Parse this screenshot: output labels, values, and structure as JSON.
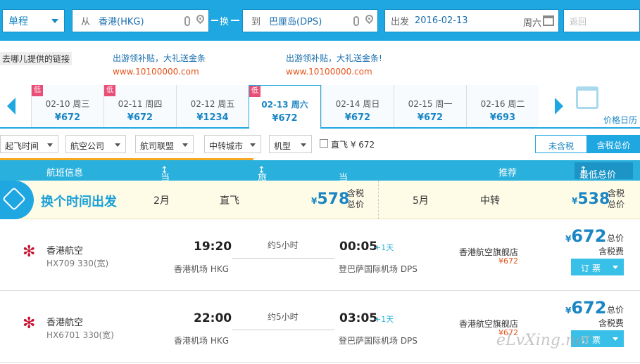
{
  "search": {
    "trip_type": "单程",
    "from_prefix": "从",
    "from_city": "香港(HKG)",
    "swap_label": "换",
    "to_prefix": "到",
    "to_city": "巴厘岛(DPS)",
    "depart_label": "出发",
    "depart_date": "2016-02-13",
    "weekday": "周六",
    "return_placeholder": "返回"
  },
  "ads": {
    "label": "去哪儿提供的链接",
    "items": [
      {
        "title": "出游领补贴，大礼送金条",
        "url": "www.10100000.com"
      },
      {
        "title": "出游领补贴，大礼送金条!",
        "url": "www.10100000.com"
      }
    ]
  },
  "dates": [
    {
      "date": "02-10 周三",
      "price": "¥672",
      "low": "低"
    },
    {
      "date": "02-11 周四",
      "price": "¥672",
      "low": "低"
    },
    {
      "date": "02-12 周五",
      "price": "¥1234",
      "low": ""
    },
    {
      "date": "02-13 周六",
      "price": "¥672",
      "low": "低"
    },
    {
      "date": "02-14 周日",
      "price": "¥672",
      "low": ""
    },
    {
      "date": "02-15 周一",
      "price": "¥672",
      "low": ""
    },
    {
      "date": "02-16 周二",
      "price": "¥693",
      "low": ""
    }
  ],
  "calendar_label": "价格日历",
  "filters": {
    "items": [
      "起飞时间",
      "航空公司",
      "航司联盟",
      "中转城市",
      "机型"
    ],
    "direct": "直飞 ¥ 672",
    "tax_excl": "未含税",
    "tax_incl": "含税总价"
  },
  "header": {
    "info": "航班信息",
    "dep": "当地起飞时间",
    "dur": "旅行总时长",
    "arr": "当地降落时间",
    "rec": "推荐",
    "low": "最低总价"
  },
  "promo": {
    "title": "换个时间出发",
    "a_month": "2月",
    "a_type": "直飞",
    "a_cur": "¥",
    "a_price": "578",
    "a_inc1": "含税",
    "a_inc2": "总价",
    "b_month": "5月",
    "b_type": "中转",
    "b_cur": "¥",
    "b_price": "538",
    "b_inc1": "含税",
    "b_inc2": "总价"
  },
  "flights": [
    {
      "airline": "香港航空",
      "flight": "HX709 330(宽)",
      "dep": "19:20",
      "duration": "约5小时",
      "arr": "00:05",
      "plus": "+1天",
      "dep_ap": "香港机场 HKG",
      "arr_ap": "登巴萨国际机场 DPS",
      "seller": "香港航空旗舰店",
      "seller_price": "¥672",
      "cur": "¥",
      "price": "672",
      "total": "总价",
      "tax": "含税费",
      "book": "订票"
    },
    {
      "airline": "香港航空",
      "flight": "HX6701 330(宽)",
      "dep": "22:00",
      "duration": "约5小时",
      "arr": "03:05",
      "plus": "+1天",
      "dep_ap": "香港机场 HKG",
      "arr_ap": "登巴萨国际机场 DPS",
      "seller": "香港航空旗舰店",
      "seller_price": "¥672",
      "cur": "¥",
      "price": "672",
      "total": "总价",
      "tax": "含税费",
      "book": "订票"
    }
  ],
  "watermark": "eLvXing.net"
}
